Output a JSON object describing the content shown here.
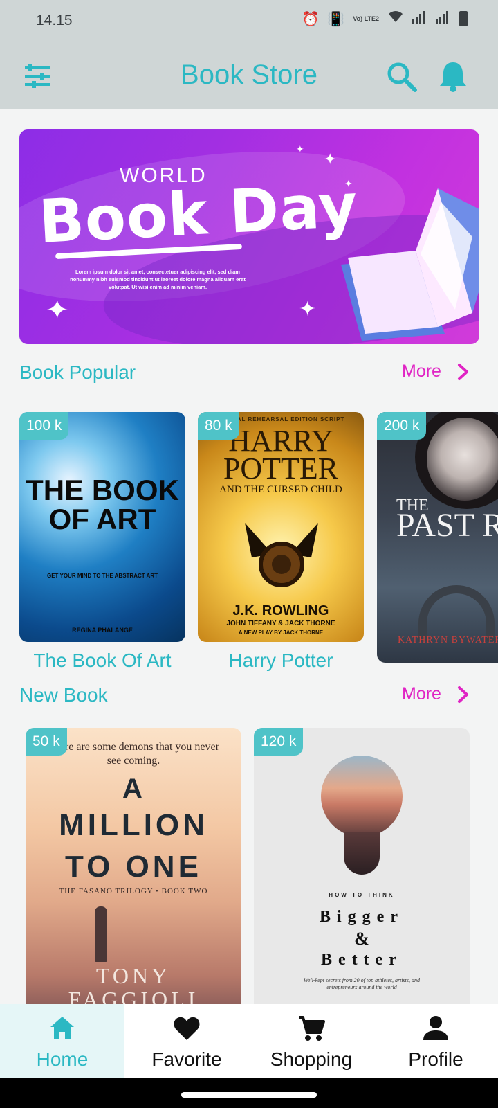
{
  "status_bar": {
    "time": "14.15",
    "network_label": "Vo) LTE2"
  },
  "app_bar": {
    "title": "Book Store",
    "menu_icon": "sliders-icon",
    "search_icon": "search-icon",
    "notification_icon": "bell-icon"
  },
  "banner": {
    "word_top": "WORLD",
    "headline": "Book Day",
    "body": "Lorem ipsum dolor sit amet, consectetuer adipiscing elit, sed diam nonummy nibh euismod tincidunt ut laoreet dolore magna aliquam erat volutpat. Ut wisi enim ad minim veniam."
  },
  "sections": {
    "popular": {
      "title": "Book Popular",
      "more_label": "More",
      "books": [
        {
          "badge": "100 k",
          "title": "The Book Of Art",
          "cover_title": "THE BOOK OF ART",
          "cover_sub": "GET YOUR MIND TO THE ABSTRACT ART",
          "cover_author": "REGINA PHALANGE"
        },
        {
          "badge": "80 k",
          "title": "Harry Potter",
          "cover_top": "SPECIAL REHEARSAL EDITION SCRIPT",
          "cover_title": "HARRY POTTER",
          "cover_sub": "AND THE CURSED CHILD",
          "cover_author": "J.K. ROWLING",
          "cover_author2": "JOHN TIFFANY & JACK THORNE",
          "cover_author3": "A NEW PLAY BY JACK THORNE"
        },
        {
          "badge": "200 k",
          "title": "",
          "cover_title_1": "THE",
          "cover_title_2": "PAST RISING",
          "cover_author": "KATHRYN BYWATERS"
        }
      ]
    },
    "new": {
      "title": "New Book",
      "more_label": "More",
      "books": [
        {
          "badge": "50 k",
          "cover_quote": "There are some demons that you never see coming.",
          "cover_title_1": "A",
          "cover_title_2": "MILLION",
          "cover_title_3": "TO ONE",
          "cover_series": "THE FASANO TRILOGY • BOOK TWO",
          "cover_author_1": "TONY",
          "cover_author_2": "FAGGIOLI"
        },
        {
          "badge": "120 k",
          "cover_kicker": "HOW TO THINK",
          "cover_title_1": "Bigger",
          "cover_title_2": "&",
          "cover_title_3": "Better",
          "cover_blurb": "Well-kept secrets from 20 of top athletes, artists, and entrepreneurs around the world"
        }
      ]
    }
  },
  "bottom_nav": [
    {
      "label": "Home",
      "icon": "home-icon",
      "active": true
    },
    {
      "label": "Favorite",
      "icon": "heart-icon",
      "active": false
    },
    {
      "label": "Shopping",
      "icon": "cart-icon",
      "active": false
    },
    {
      "label": "Profile",
      "icon": "person-icon",
      "active": false
    }
  ],
  "colors": {
    "accent": "#2bb8c3",
    "more": "#e024c4",
    "badge": "#4fc3c8"
  }
}
